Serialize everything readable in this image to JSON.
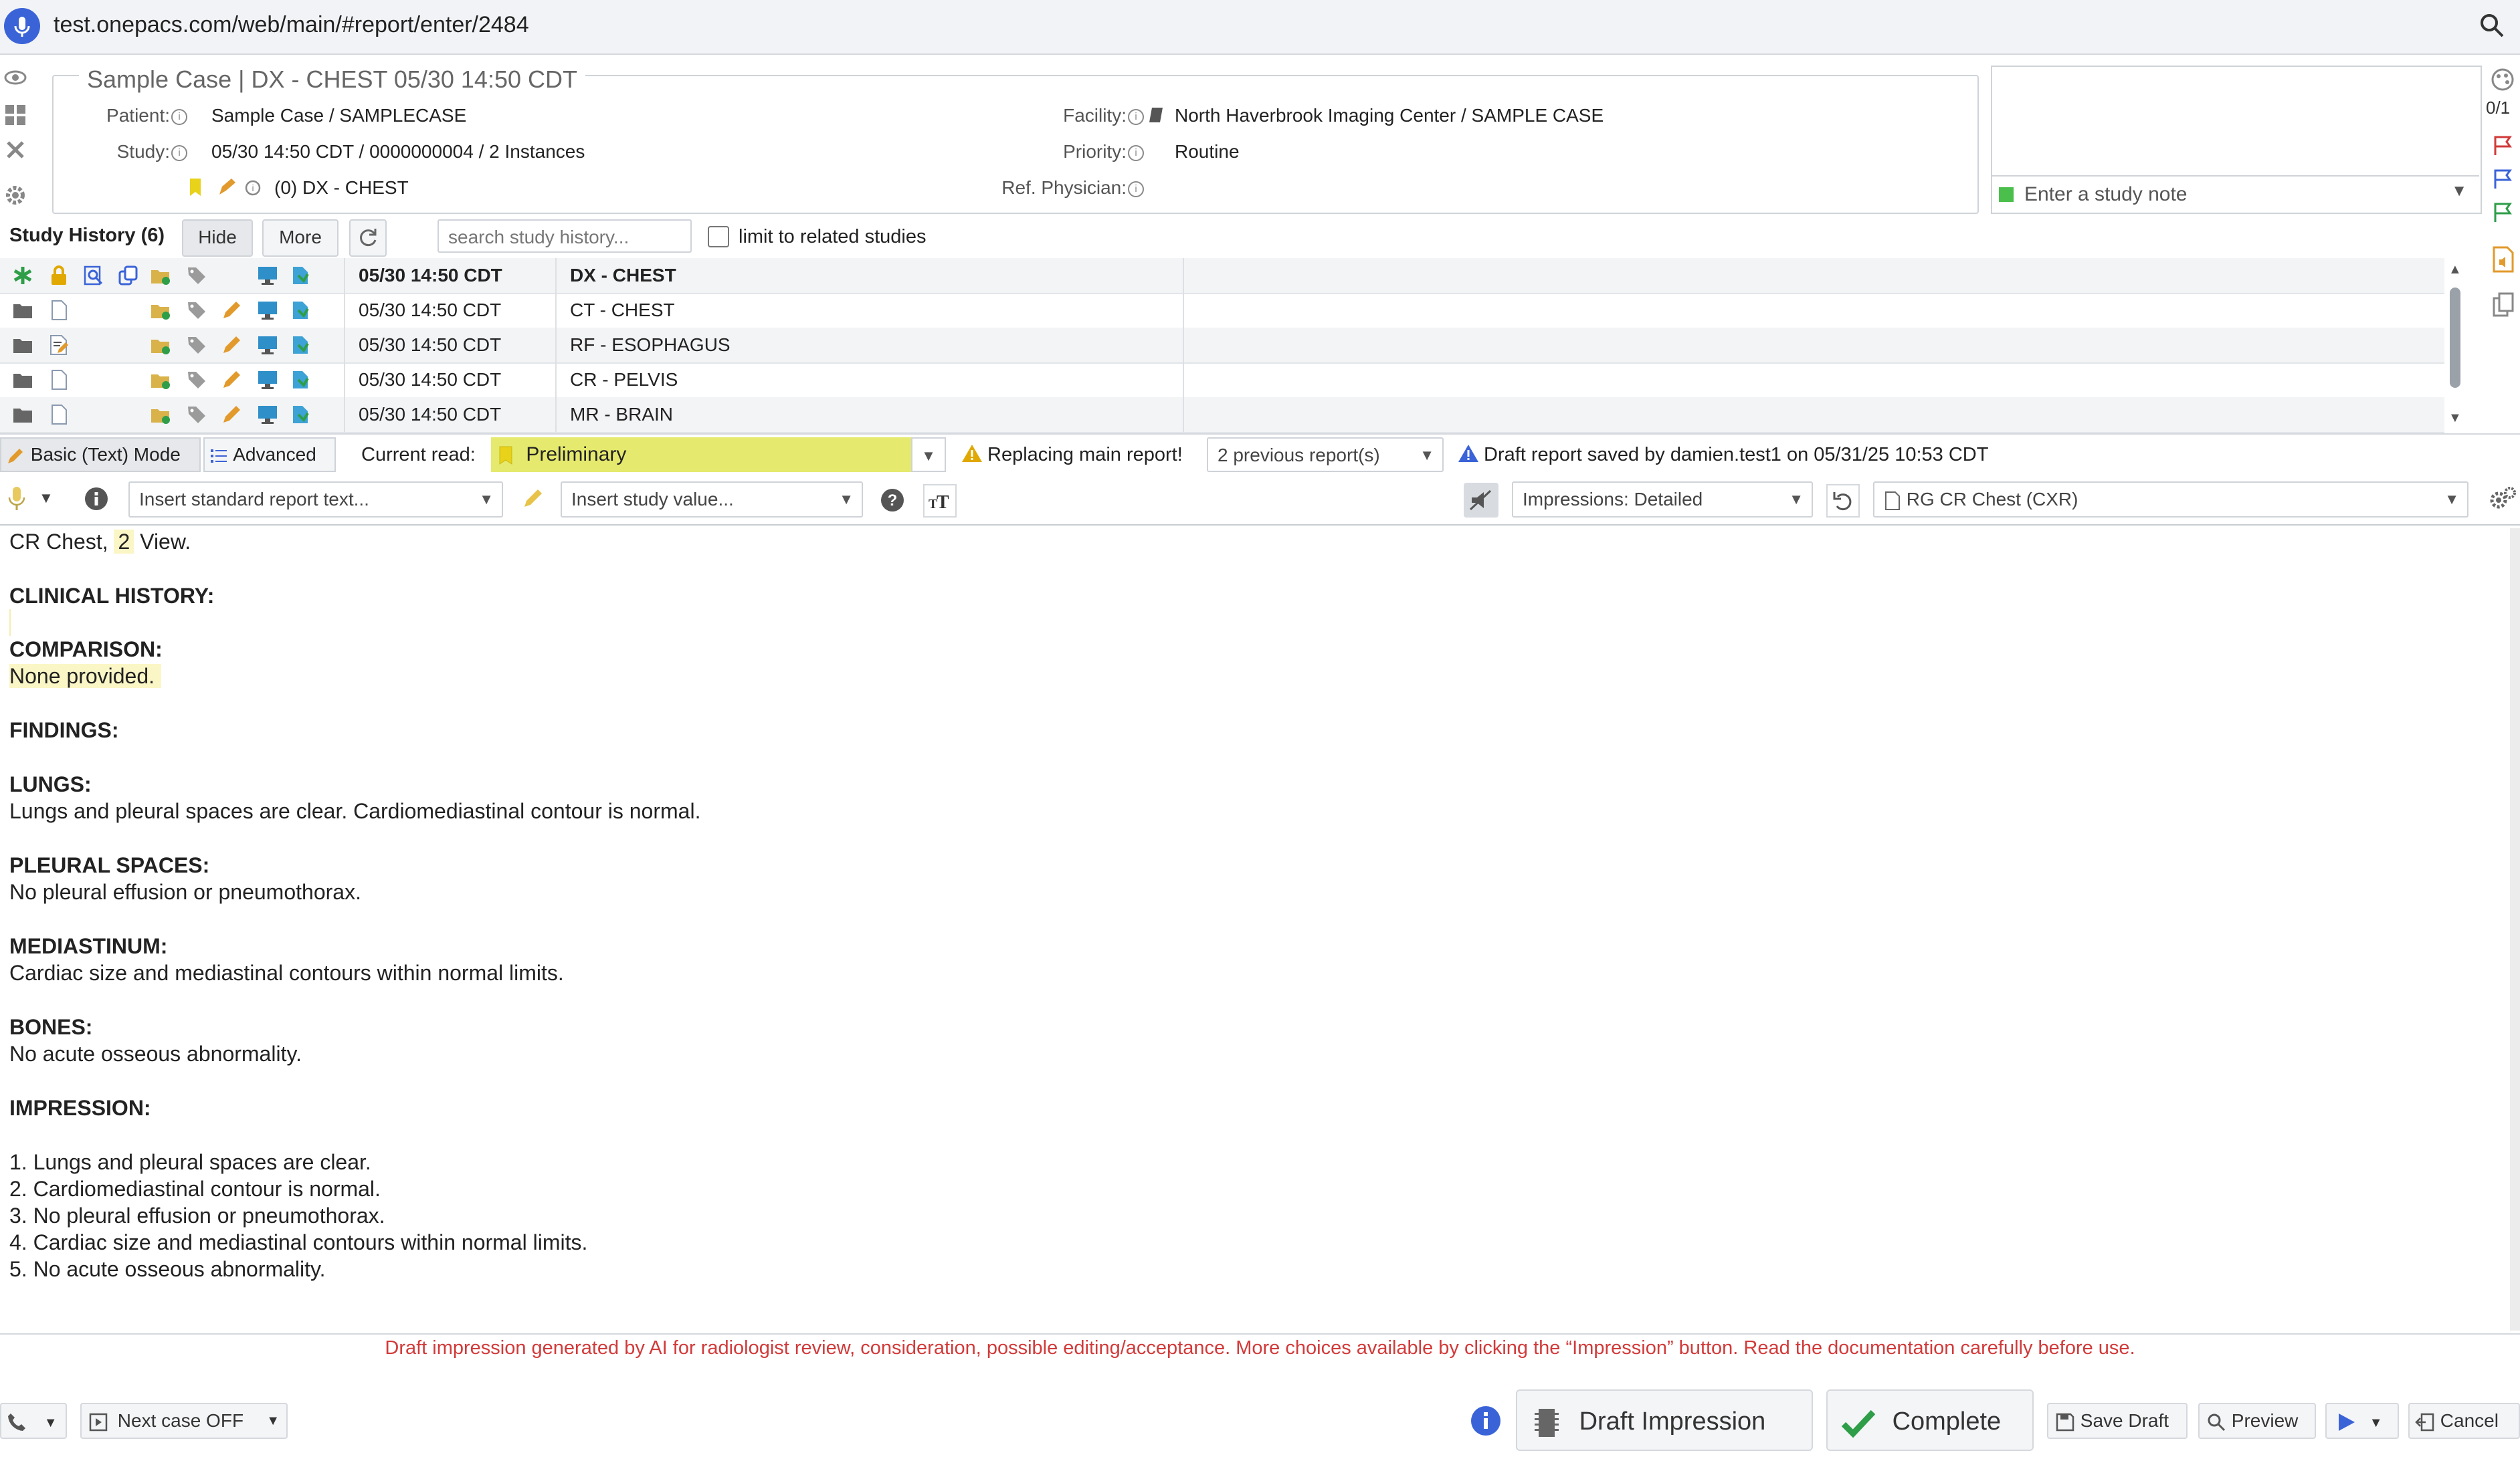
{
  "browser": {
    "url": "test.onepacs.com/web/main/#report/enter/2484"
  },
  "case": {
    "title": "Sample Case | DX - CHEST 05/30 14:50 CDT",
    "patient_label": "Patient:",
    "patient_value": "Sample Case / SAMPLECASE",
    "study_label": "Study:",
    "study_value": "05/30 14:50 CDT / 0000000004 / 2 Instances",
    "study_sub": "(0) DX - CHEST",
    "facility_label": "Facility:",
    "facility_value": "North Haverbrook Imaging Center / SAMPLE CASE",
    "priority_label": "Priority:",
    "priority_value": "Routine",
    "ref_label": "Ref. Physician:"
  },
  "note": {
    "placeholder": "Enter a study note"
  },
  "right_rail": {
    "counter": "0/1"
  },
  "history": {
    "title": "Study History (6)",
    "hide_label": "Hide",
    "more_label": "More",
    "search_placeholder": "search study history...",
    "limit_label": "limit to related studies",
    "rows": [
      {
        "date": "05/30 14:50 CDT",
        "desc": "DX - CHEST"
      },
      {
        "date": "05/30 14:50 CDT",
        "desc": "CT - CHEST"
      },
      {
        "date": "05/30 14:50 CDT",
        "desc": "RF - ESOPHAGUS"
      },
      {
        "date": "05/30 14:50 CDT",
        "desc": "CR - PELVIS"
      },
      {
        "date": "05/30 14:50 CDT",
        "desc": "MR - BRAIN"
      }
    ]
  },
  "mode": {
    "basic_label": "Basic (Text) Mode",
    "advanced_label": "Advanced",
    "current_read_label": "Current read:",
    "current_read_value": "Preliminary",
    "replacing_label": "Replacing main report!",
    "previous_reports": "2 previous report(s)",
    "draft_saved": "Draft report saved by damien.test1 on 05/31/25 10:53 CDT"
  },
  "toolbar": {
    "insert_standard": "Insert standard report text...",
    "insert_study": "Insert study value...",
    "impressions": "Impressions: Detailed",
    "template": "RG CR Chest (CXR)"
  },
  "report": {
    "line1_a": "CR Chest,",
    "line1_num": "2",
    "line1_b": "View.",
    "clinical_history": "CLINICAL HISTORY:",
    "comparison": "COMPARISON:",
    "comparison_text": "None provided.",
    "findings": "FINDINGS:",
    "lungs": "LUNGS:",
    "lungs_text": "Lungs and pleural spaces are clear. Cardiomediastinal contour is normal.",
    "pleural": "PLEURAL SPACES:",
    "pleural_text": "No pleural effusion or pneumothorax.",
    "mediastinum": "MEDIASTINUM:",
    "mediastinum_text": "Cardiac size and mediastinal contours within normal limits.",
    "bones": "BONES:",
    "bones_text": "No acute osseous abnormality.",
    "impression": "IMPRESSION:",
    "imp1": "1. Lungs and pleural spaces are clear.",
    "imp2": "2. Cardiomediastinal contour is normal.",
    "imp3": "3. No pleural effusion or pneumothorax.",
    "imp4": "4. Cardiac size and mediastinal contours within normal limits.",
    "imp5": "5. No acute osseous abnormality."
  },
  "disclaimer": "Draft impression generated by AI for radiologist review, consideration, possible editing/acceptance. More choices available by clicking the “Impression” button. Read the documentation carefully before use.",
  "bottom": {
    "next_case": "Next case OFF",
    "draft_impression": "Draft Impression",
    "complete": "Complete",
    "save_draft": "Save Draft",
    "preview": "Preview",
    "cancel": "Cancel"
  },
  "colors": {
    "accent": "#3b63d8",
    "prelim": "#e5ea6e",
    "warning": "#e0a800",
    "danger": "#d23a3a",
    "success": "#2e9e48"
  }
}
